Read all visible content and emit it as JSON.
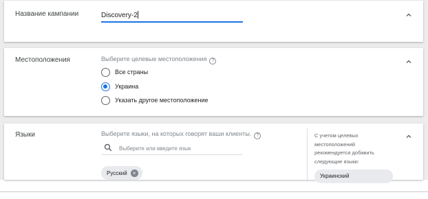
{
  "campaign_name": {
    "title": "Название кампании",
    "value": "Discovery-2"
  },
  "locations": {
    "title": "Местоположения",
    "helper": "Выберите целевые местоположения",
    "options": [
      {
        "label": "Все страны",
        "checked": false
      },
      {
        "label": "Украина",
        "checked": true
      },
      {
        "label": "Указать другое местоположение",
        "checked": false
      }
    ]
  },
  "languages": {
    "title": "Языки",
    "helper": "Выберите языки, на которых говорят ваши клиенты.",
    "search_placeholder": "Выберите или введите язык",
    "selected": [
      "Русский"
    ],
    "recommendation": "С учетом целевых местоположений рекомендуется добавить следующие языки:",
    "recommended": [
      "Украинский"
    ]
  },
  "icons": {
    "collapse": "chevron-up-icon",
    "help": "help-circle-icon",
    "search": "search-icon",
    "remove": "close-circle-icon"
  },
  "colors": {
    "accent": "#1a73e8",
    "chip_bg": "#e8eaed",
    "page_bg": "#ececec"
  }
}
